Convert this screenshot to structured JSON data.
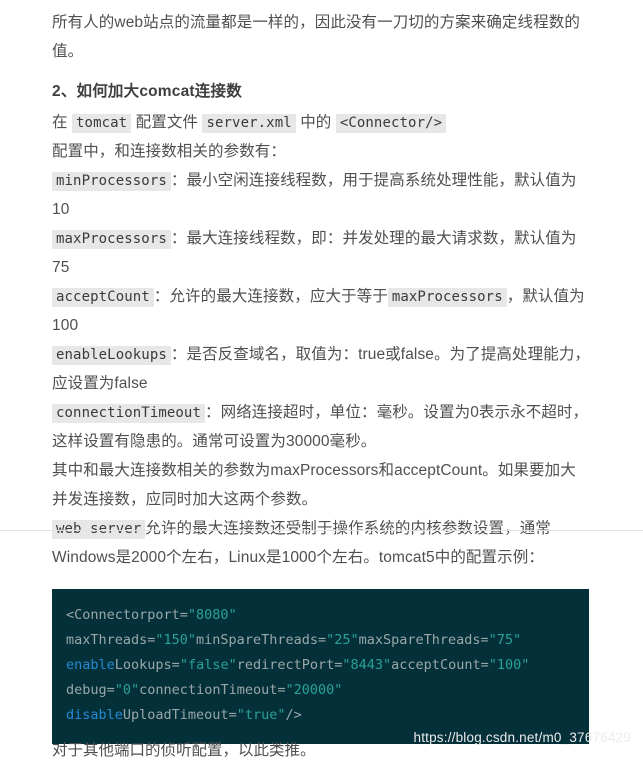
{
  "article": {
    "intro_paragraph": {
      "text": "所有人的web站点的流量都是一样的，因此没有一刀切的方案来确定线程数的值。"
    },
    "heading": "2、如何加大comcat连接数",
    "line_connector": {
      "part1": "在",
      "chip1": "tomcat",
      "part2": "配置文件",
      "chip2": "server.xml",
      "part3": "中的",
      "chip3": "<Connector/>"
    },
    "line_params_intro": "配置中，和连接数相关的参数有：",
    "params": [
      {
        "chip": "minProcessors",
        "text": "：最小空闲连接线程数，用于提高系统处理性能，默认值为10"
      },
      {
        "chip": "maxProcessors",
        "text": "：最大连接线程数，即：并发处理的最大请求数，默认值为75"
      },
      {
        "chip": "acceptCount",
        "text_before": "：允许的最大连接数，应大于等于",
        "chip_inline": "maxProcessors",
        "text_after": "，默认值为100"
      },
      {
        "chip": "enableLookups",
        "text": "：是否反查域名，取值为：true或false。为了提高处理能力，应设置为false"
      },
      {
        "chip": "connectionTimeout",
        "text": "：网络连接超时，单位：毫秒。设置为0表示永不超时，这样设置有隐患的。通常可设置为30000毫秒。"
      }
    ],
    "line_summary": "其中和最大连接数相关的参数为maxProcessors和acceptCount。如果要加大并发连接数，应同时加大这两个参数。",
    "line_webserver": {
      "chip": "web server",
      "text": "允许的最大连接数还受制于操作系统的内核参数设置，通常Windows是2000个左右，Linux是1000个左右。tomcat5中的配置示例："
    },
    "tail_paragraph": "对于其他端口的侦听配置，以此类推。"
  },
  "code_block": {
    "language": "xml",
    "background_color": "#04303a",
    "lines": [
      [
        {
          "t": "<Connectorport=",
          "c": "plain"
        },
        {
          "t": "\"8080\"",
          "c": "str"
        }
      ],
      [
        {
          "t": "maxThreads=",
          "c": "plain"
        },
        {
          "t": "\"150\"",
          "c": "str"
        },
        {
          "t": "minSpareThreads=",
          "c": "plain"
        },
        {
          "t": "\"25\"",
          "c": "str"
        },
        {
          "t": "maxSpareThreads=",
          "c": "plain"
        },
        {
          "t": "\"75\"",
          "c": "str"
        }
      ],
      [
        {
          "t": "enable",
          "c": "kw"
        },
        {
          "t": "Lookups=",
          "c": "plain"
        },
        {
          "t": "\"false\"",
          "c": "str"
        },
        {
          "t": "redirectPort=",
          "c": "plain"
        },
        {
          "t": "\"8443\"",
          "c": "str"
        },
        {
          "t": "acceptCount=",
          "c": "plain"
        },
        {
          "t": "\"100\"",
          "c": "str"
        }
      ],
      [
        {
          "t": "debug=",
          "c": "plain"
        },
        {
          "t": "\"0\"",
          "c": "str"
        },
        {
          "t": "connectionTimeout=",
          "c": "plain"
        },
        {
          "t": "\"20000\"",
          "c": "str"
        }
      ],
      [
        {
          "t": "disable",
          "c": "kw"
        },
        {
          "t": "UploadTimeout=",
          "c": "plain"
        },
        {
          "t": "\"true\"",
          "c": "str"
        },
        {
          "t": "/>",
          "c": "plain"
        }
      ]
    ]
  },
  "watermark": {
    "text": "https://blog.csdn.net/m0_37676429"
  }
}
